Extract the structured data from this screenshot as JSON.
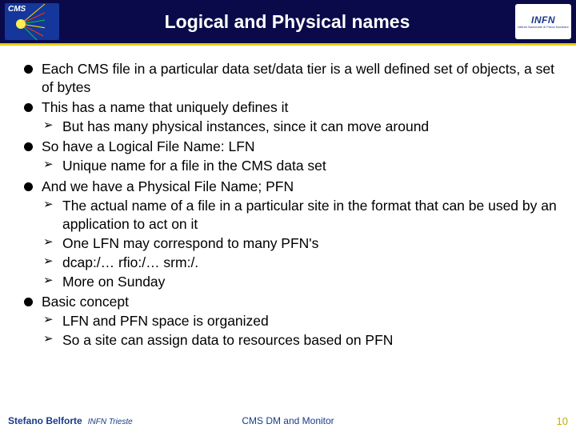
{
  "header": {
    "title": "Logical and Physical names",
    "logo_left_text": "CMS",
    "logo_right_main": "INFN",
    "logo_right_sub": "Istituto Nazionale di Fisica Nucleare"
  },
  "bullets": [
    {
      "text": "Each CMS file in a particular data set/data tier is a well defined set of objects, a set of bytes",
      "sub": []
    },
    {
      "text": "This has a name that uniquely defines it",
      "sub": [
        "But has many physical instances, since it can move around"
      ]
    },
    {
      "text": "So have a Logical File Name: LFN",
      "sub": [
        "Unique name for a file in the CMS data set"
      ]
    },
    {
      "text": "And we have a Physical File Name; PFN",
      "sub": [
        "The actual name of a file in a particular site in the format that can be used by an application to act on it",
        "One LFN may correspond to many PFN's",
        "dcap:/… rfio:/… srm:/.",
        "More on Sunday"
      ]
    },
    {
      "text": "Basic concept",
      "sub": [
        "LFN and PFN space is organized",
        "So a site can assign data to resources based on PFN"
      ]
    }
  ],
  "footer": {
    "author": "Stefano Belforte",
    "affiliation": "INFN Trieste",
    "center": "CMS DM and Monitor",
    "page": "10"
  }
}
